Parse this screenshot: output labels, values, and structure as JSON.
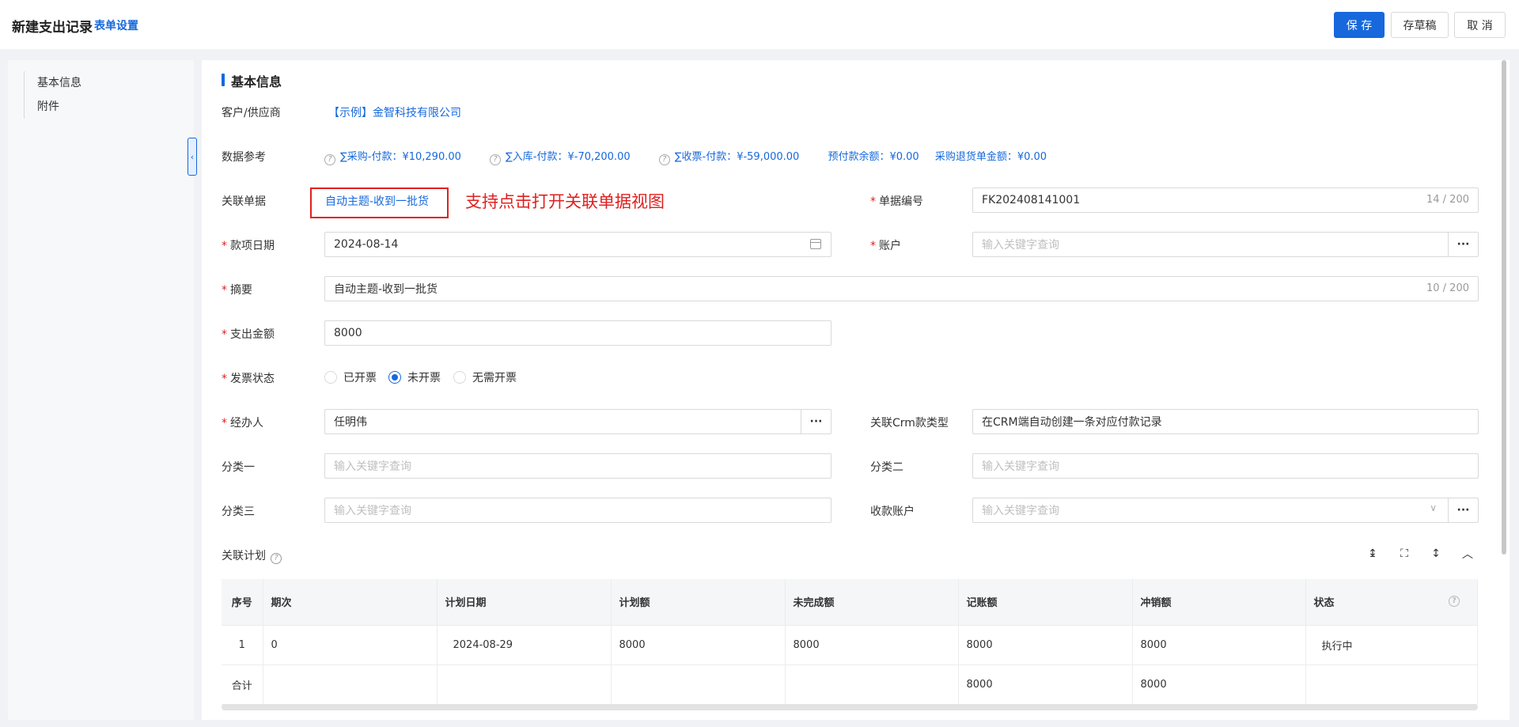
{
  "header": {
    "title": "新建支出记录",
    "form_settings": "表单设置",
    "save": "保 存",
    "draft": "存草稿",
    "cancel": "取 消"
  },
  "sidebar": {
    "items": [
      {
        "label": "基本信息"
      },
      {
        "label": "附件"
      }
    ]
  },
  "section": {
    "title": "基本信息"
  },
  "form": {
    "customer": {
      "label": "客户/供应商",
      "value": "【示例】金智科技有限公司"
    },
    "data_ref": {
      "label": "数据参考",
      "items": [
        "∑采购-付款：¥10,290.00",
        "∑入库-付款：¥-70,200.00",
        "∑收票-付款：¥-59,000.00",
        "预付款余额：¥0.00",
        "采购退货单金额：¥0.00"
      ]
    },
    "related_doc": {
      "label": "关联单据",
      "value": "自动主题-收到一批货"
    },
    "note": "支持点击打开关联单据视图",
    "doc_no": {
      "label": "单据编号",
      "value": "FK202408141001",
      "count": "14 / 200"
    },
    "date": {
      "label": "款项日期",
      "value": "2024-08-14"
    },
    "account": {
      "label": "账户",
      "placeholder": "输入关键字查询"
    },
    "summary": {
      "label": "摘要",
      "value": "自动主题-收到一批货",
      "count": "10 / 200"
    },
    "amount": {
      "label": "支出金额",
      "value": "8000"
    },
    "invoice": {
      "label": "发票状态",
      "options": [
        "已开票",
        "未开票",
        "无需开票"
      ],
      "selected": "未开票"
    },
    "handler": {
      "label": "经办人",
      "value": "任明伟"
    },
    "crm_type": {
      "label": "关联Crm款类型",
      "value": "在CRM端自动创建一条对应付款记录"
    },
    "cat1": {
      "label": "分类一",
      "placeholder": "输入关键字查询"
    },
    "cat2": {
      "label": "分类二",
      "placeholder": "输入关键字查询"
    },
    "cat3": {
      "label": "分类三",
      "placeholder": "输入关键字查询"
    },
    "receive_account": {
      "label": "收款账户",
      "placeholder": "输入关键字查询"
    }
  },
  "plan": {
    "title": "关联计划",
    "columns": [
      "序号",
      "期次",
      "计划日期",
      "计划额",
      "未完成额",
      "记账额",
      "冲销额",
      "状态"
    ],
    "rows": [
      [
        "1",
        "0",
        "2024-08-29",
        "8000",
        "8000",
        "8000",
        "8000",
        "执行中"
      ]
    ],
    "total": [
      "合计",
      "",
      "",
      "",
      "",
      "8000",
      "8000",
      ""
    ]
  },
  "icons": [
    "calendar-icon",
    "ellipsis-icon",
    "chevron-down-icon",
    "help-icon",
    "row-height-icon",
    "fullscreen-icon",
    "column-height-icon",
    "collapse-up-icon",
    "sidebar-collapse-icon"
  ],
  "colors": {
    "primary": "#1668dc",
    "required": "#e02020",
    "annotation": "#e02020"
  }
}
